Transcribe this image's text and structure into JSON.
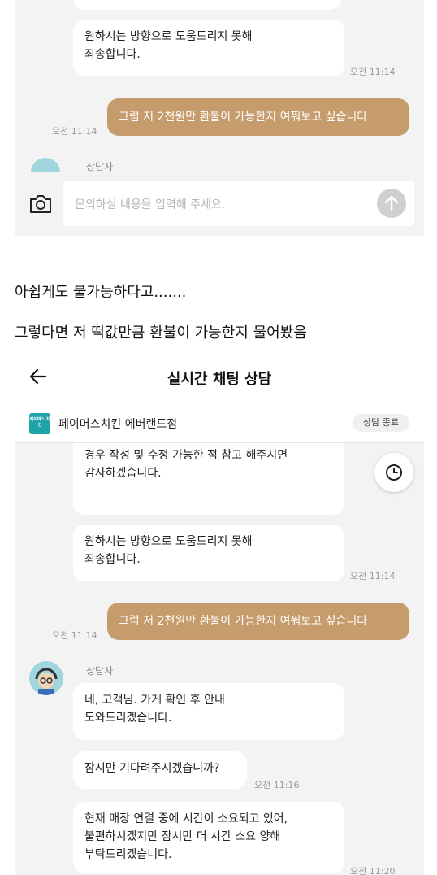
{
  "top_panel": {
    "msg_sorry": "원하시는 방향으로 도움드리지 못해\n죄송합니다.",
    "msg_sorry_time": "오전 11:14",
    "msg_user": "그럼 저 2천원만 환불이 가능한지 여쭤보고 싶습니다",
    "msg_user_time": "오전 11:14",
    "sender": "상담사",
    "input_placeholder": "문의하실 내용을 입력해 주세요."
  },
  "captions": {
    "line1": "아쉽게도 불가능하다고.......",
    "line2": "그렇다면 저 떡값만큼 환불이 가능한지 물어봤음"
  },
  "chat": {
    "title": "실시간 채팅 상담",
    "store_name": "페이머스치킨 에버랜드점",
    "end_button": "상담 종료",
    "logo_text": "페이머스 치킨",
    "msg_partial": "경우 작성 및 수정 가능한 점 참고 해주시면\n감사하겠습니다.",
    "msg_sorry": "원하시는 방향으로 도움드리지 못해\n죄송합니다.",
    "msg_sorry_time": "오전 11:14",
    "msg_user": "그럼 저 2천원만 환불이 가능한지 여쭤보고 싶습니다",
    "msg_user_time": "오전 11:14",
    "sender": "상담사",
    "msg_confirm": "네, 고객님. 가게 확인 후 안내\n도와드리겠습니다.",
    "msg_wait": "잠시만 기다려주시겠습니까?",
    "msg_wait_time": "오전 11:16",
    "msg_delay": "현재 매장 연결 중에 시간이 소요되고 있어,\n불편하시겠지만 잠시만 더 시간 소요 양해\n부탁드리겠습니다.",
    "msg_delay_time": "오전 11:20"
  },
  "colors": {
    "user_bubble": "#c69c6d",
    "chat_background": "#f3f3f3",
    "send_button": "#d0d0d0"
  },
  "icons": [
    "camera-icon",
    "send-arrow-icon",
    "back-arrow-icon",
    "clock-icon",
    "agent-avatar-icon"
  ]
}
